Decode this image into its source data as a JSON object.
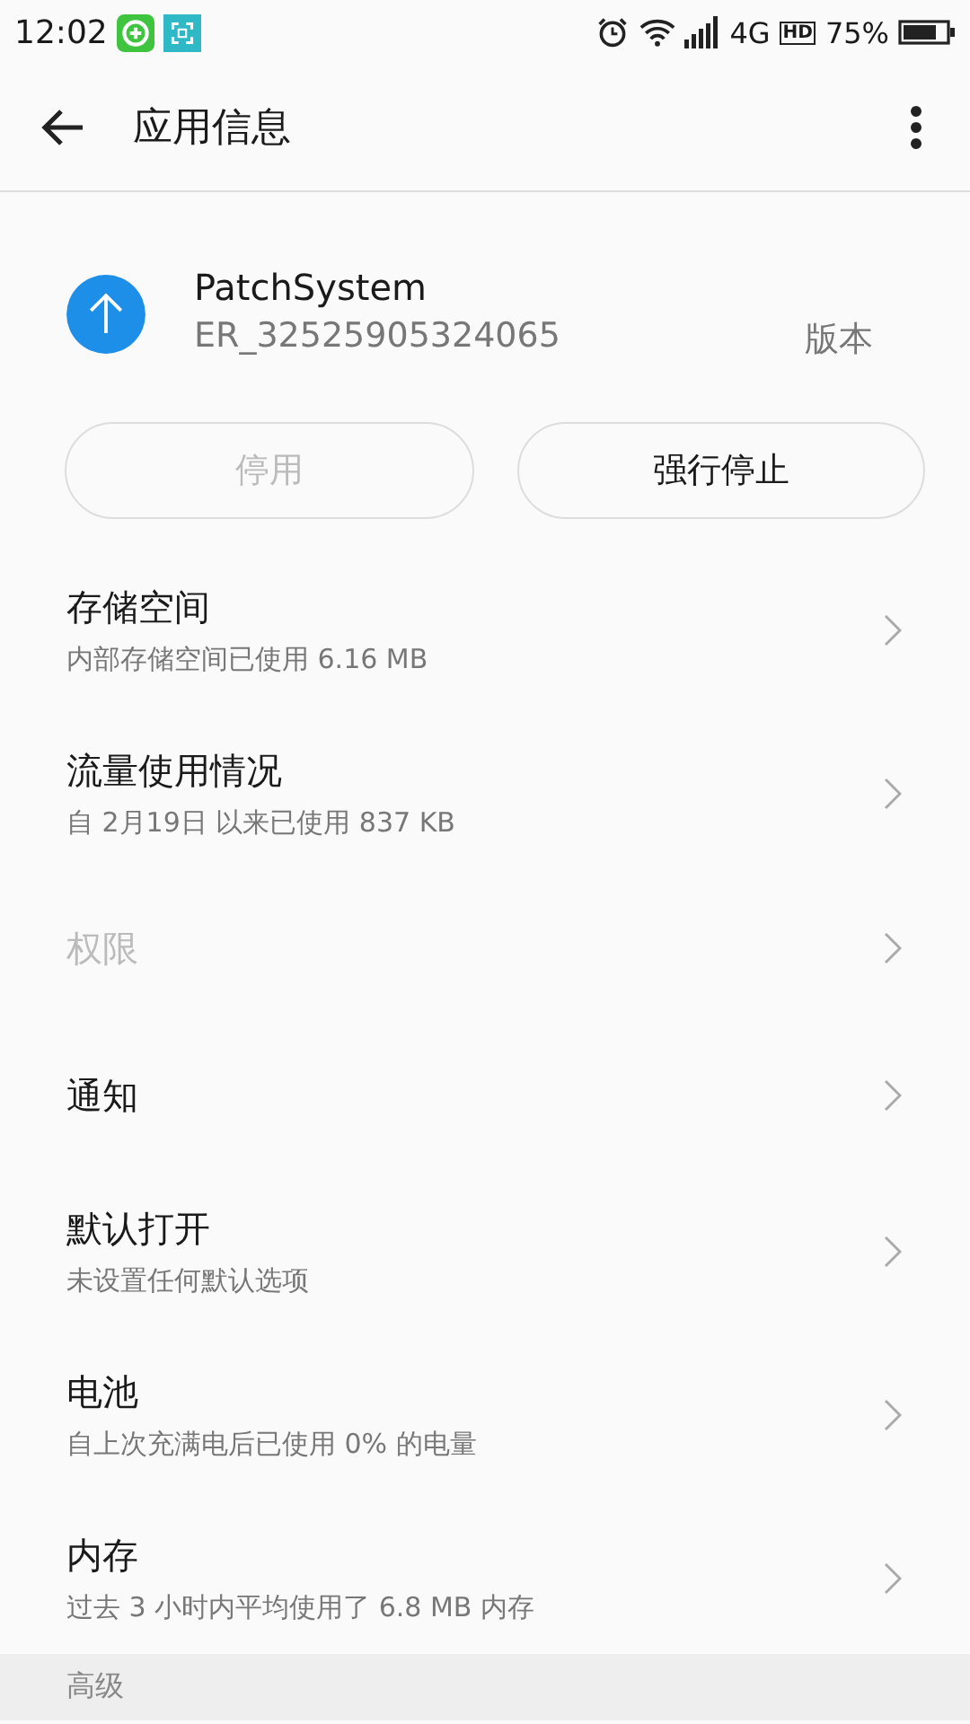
{
  "status_bar": {
    "time": "12:02",
    "network": "4G",
    "hd": "HD",
    "battery": "75%"
  },
  "header": {
    "title": "应用信息"
  },
  "app": {
    "name": "PatchSystem",
    "version": "ER_32525905324065",
    "version_label": "版本"
  },
  "buttons": [
    {
      "label": "停用",
      "disabled": true
    },
    {
      "label": "强行停止",
      "disabled": false
    }
  ],
  "items": [
    {
      "title": "存储空间",
      "subtitle": "内部存储空间已使用 6.16 MB",
      "disabled": false
    },
    {
      "title": "流量使用情况",
      "subtitle": "自 2月19日 以来已使用 837 KB",
      "disabled": false
    },
    {
      "title": "权限",
      "disabled": true
    },
    {
      "title": "通知",
      "disabled": false
    },
    {
      "title": "默认打开",
      "subtitle": "未设置任何默认选项",
      "disabled": false
    },
    {
      "title": "电池",
      "subtitle": "自上次充满电后已使用 0% 的电量",
      "disabled": false
    },
    {
      "title": "内存",
      "subtitle": "过去 3 小时内平均使用了 6.8 MB 内存",
      "disabled": false
    }
  ],
  "section": {
    "title": "高级"
  }
}
